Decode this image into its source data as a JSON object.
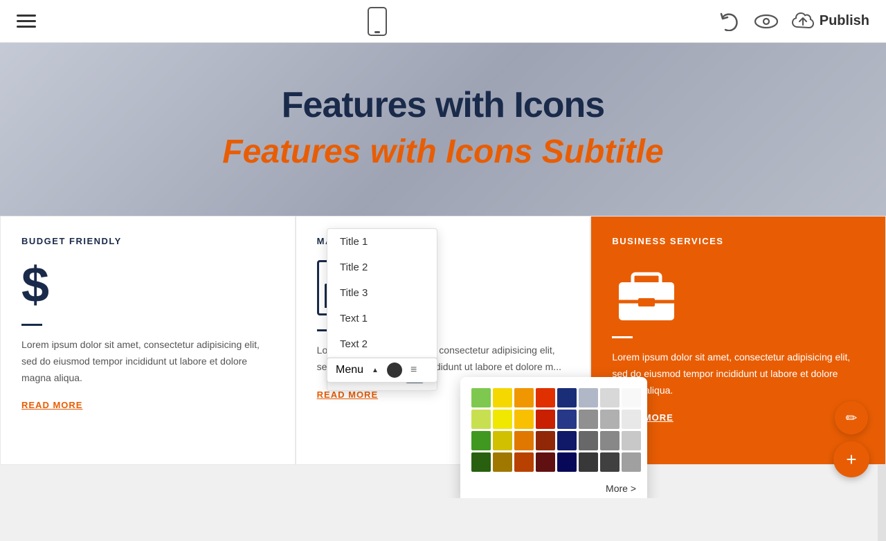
{
  "toolbar": {
    "publish_label": "Publish"
  },
  "hero": {
    "title": "Features with Icons",
    "subtitle": "Features with Icons Subtitle"
  },
  "cards": [
    {
      "label": "BUDGET FRIENDLY",
      "text": "Lorem ipsum dolor sit amet, consectetur adipisicing elit, sed do eiusmod tempor incididunt ut labore et dolore magna aliqua.",
      "link": "READ MORE",
      "type": "white"
    },
    {
      "label": "MARKET ANA...",
      "text": "Lorem ipsum dolor sit amet, consectetur adipisicing elit, sed do eiusmod tempor incididunt ut labore et dolore m...",
      "link": "READ MORE",
      "type": "white"
    },
    {
      "label": "BUSINESS SERVICES",
      "text": "Lorem ipsum dolor sit amet, consectetur adipisicing elit, sed do eiusmod tempor incididunt ut labore et dolore magna aliqua.",
      "link": "READ MORE",
      "type": "orange"
    }
  ],
  "dropdown": {
    "items": [
      {
        "label": "Title 1"
      },
      {
        "label": "Title 2"
      },
      {
        "label": "Title 3"
      },
      {
        "label": "Text 1"
      },
      {
        "label": "Text 2"
      },
      {
        "label": "Menu"
      }
    ]
  },
  "menu_bar": {
    "label": "Menu"
  },
  "color_picker": {
    "more_label": "More >",
    "colors": [
      "#7ec850",
      "#f5d800",
      "#f09600",
      "#e03000",
      "#1a2e78",
      "#b0b8c8",
      "#d8d8d8",
      "#f8f8f8",
      "#c8e050",
      "#f0e800",
      "#f8c000",
      "#c82000",
      "#283888",
      "#909090",
      "#b0b0b0",
      "#e8e8e8",
      "#409820",
      "#d0c000",
      "#e07800",
      "#902808",
      "#101868",
      "#686868",
      "#888888",
      "#c8c8c8",
      "#286010",
      "#a07800",
      "#b84000",
      "#601010",
      "#080858",
      "#383838",
      "#404040",
      "#a0a0a0"
    ]
  }
}
